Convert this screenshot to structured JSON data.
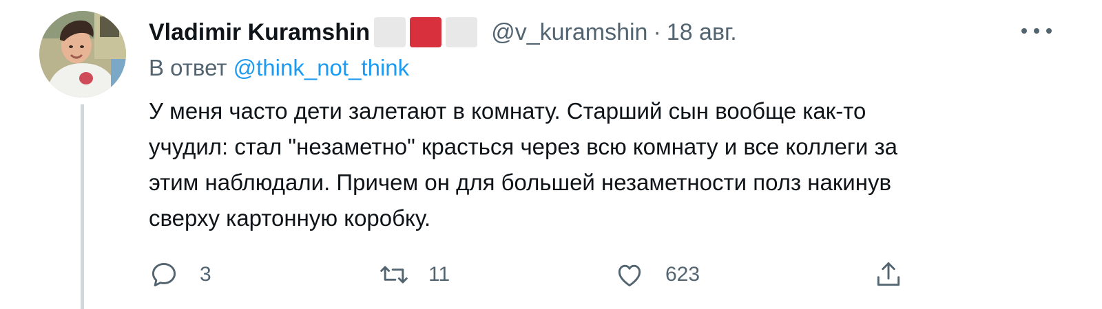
{
  "tweet": {
    "author": {
      "name": "Vladimir Kuramshin",
      "handle": "@v_kuramshin",
      "separator": "·",
      "date": "18 авг."
    },
    "flag_colors": [
      "#e8e8e8",
      "#d9303e",
      "#e8e8e8"
    ],
    "reply": {
      "prefix": "В ответ",
      "mention": "@think_not_think"
    },
    "text_lines": [
      "У меня часто дети залетают в комнату. Старший сын вообще как-то",
      "учудил: стал \"незаметно\" красться через всю комнату и все коллеги за",
      "этим наблюдали. Причем он для большей незаметности полз накинув",
      "сверху картонную коробку."
    ],
    "actions": {
      "reply_count": "3",
      "retweet_count": "11",
      "like_count": "623"
    },
    "icons": {
      "reply": "comment-bubble-icon",
      "retweet": "retweet-icon",
      "like": "heart-icon",
      "share": "share-upload-icon",
      "more": "more-dots-icon"
    },
    "colors": {
      "text": "#0f1419",
      "secondary": "#536471",
      "link": "#1d9bf0",
      "thread_line": "#cfd9de"
    }
  }
}
